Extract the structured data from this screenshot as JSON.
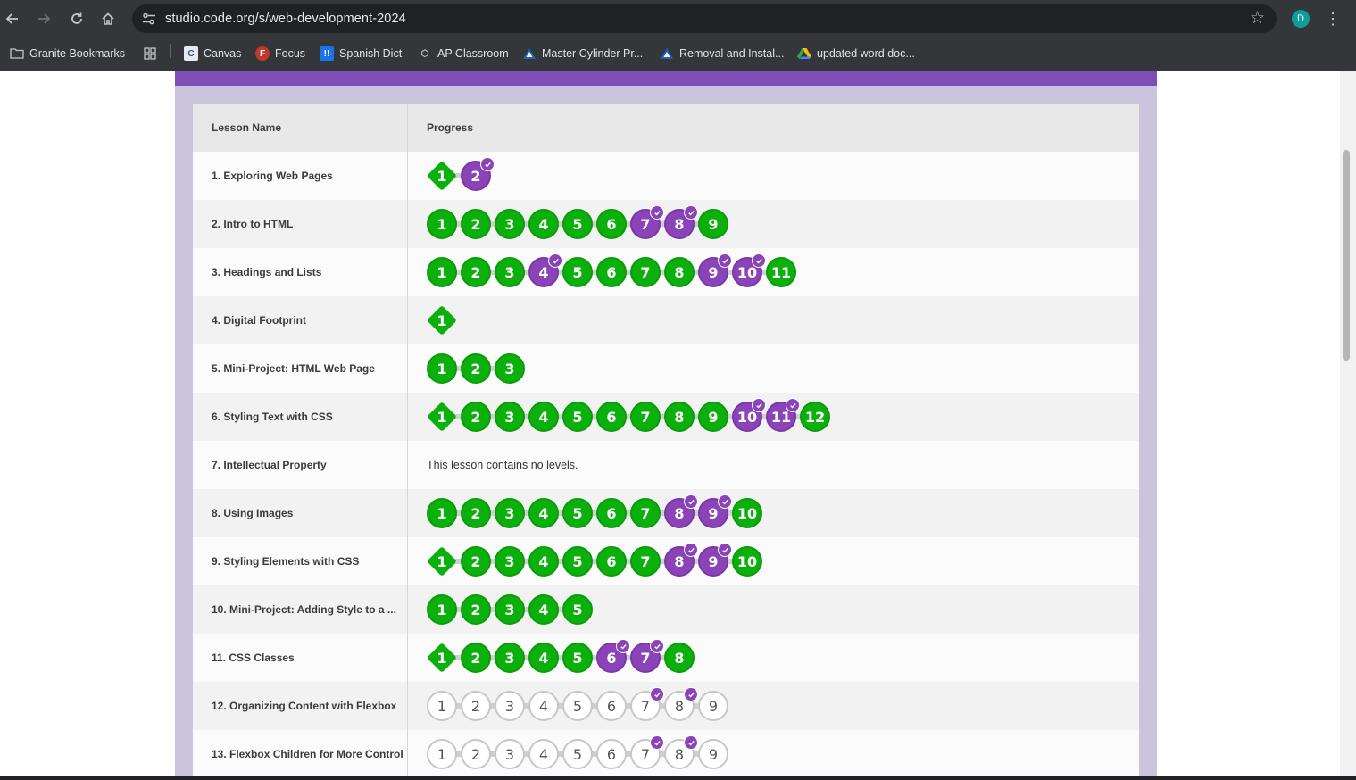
{
  "browser": {
    "url": "studio.code.org/s/web-development-2024",
    "profile_initial": "D",
    "bookmarks": [
      {
        "label": "Granite Bookmarks",
        "icon": "folder-icon"
      },
      {
        "label": "",
        "icon": "apps-grid-icon"
      },
      {
        "label": "Canvas",
        "icon": "canvas-icon"
      },
      {
        "label": "Focus",
        "icon": "focus-icon"
      },
      {
        "label": "Spanish Dict",
        "icon": "spanishdict-icon"
      },
      {
        "label": "AP Classroom",
        "icon": "apclassroom-icon"
      },
      {
        "label": "Master Cylinder Pr...",
        "icon": "alldata-icon"
      },
      {
        "label": "Removal and Instal...",
        "icon": "alldata-icon"
      },
      {
        "label": "updated word doc...",
        "icon": "drive-icon"
      }
    ]
  },
  "table": {
    "headers": {
      "lesson": "Lesson Name",
      "progress": "Progress"
    },
    "no_levels_text": "This lesson contains no levels.",
    "rows": [
      {
        "name": "1. Exploring Web Pages",
        "levels": [
          {
            "n": "1",
            "s": "diamond"
          },
          {
            "n": "2",
            "s": "purple",
            "c": true
          }
        ]
      },
      {
        "name": "2. Intro to HTML",
        "levels": [
          {
            "n": "1",
            "s": "green"
          },
          {
            "n": "2",
            "s": "green"
          },
          {
            "n": "3",
            "s": "green"
          },
          {
            "n": "4",
            "s": "green"
          },
          {
            "n": "5",
            "s": "green"
          },
          {
            "n": "6",
            "s": "green"
          },
          {
            "n": "7",
            "s": "purple",
            "c": true
          },
          {
            "n": "8",
            "s": "purple",
            "c": true
          },
          {
            "n": "9",
            "s": "green"
          }
        ]
      },
      {
        "name": "3. Headings and Lists",
        "levels": [
          {
            "n": "1",
            "s": "green"
          },
          {
            "n": "2",
            "s": "green"
          },
          {
            "n": "3",
            "s": "green"
          },
          {
            "n": "4",
            "s": "purple",
            "c": true
          },
          {
            "n": "5",
            "s": "green"
          },
          {
            "n": "6",
            "s": "green"
          },
          {
            "n": "7",
            "s": "green"
          },
          {
            "n": "8",
            "s": "green"
          },
          {
            "n": "9",
            "s": "purple",
            "c": true
          },
          {
            "n": "10",
            "s": "purple",
            "c": true
          },
          {
            "n": "11",
            "s": "green"
          }
        ]
      },
      {
        "name": "4. Digital Footprint",
        "levels": [
          {
            "n": "1",
            "s": "diamond"
          }
        ]
      },
      {
        "name": "5. Mini-Project: HTML Web Page",
        "levels": [
          {
            "n": "1",
            "s": "green"
          },
          {
            "n": "2",
            "s": "green"
          },
          {
            "n": "3",
            "s": "green"
          }
        ]
      },
      {
        "name": "6. Styling Text with CSS",
        "levels": [
          {
            "n": "1",
            "s": "diamond"
          },
          {
            "n": "2",
            "s": "green"
          },
          {
            "n": "3",
            "s": "green"
          },
          {
            "n": "4",
            "s": "green"
          },
          {
            "n": "5",
            "s": "green"
          },
          {
            "n": "6",
            "s": "green"
          },
          {
            "n": "7",
            "s": "green"
          },
          {
            "n": "8",
            "s": "green"
          },
          {
            "n": "9",
            "s": "green"
          },
          {
            "n": "10",
            "s": "purple",
            "c": true
          },
          {
            "n": "11",
            "s": "purple",
            "c": true
          },
          {
            "n": "12",
            "s": "green"
          }
        ]
      },
      {
        "name": "7. Intellectual Property",
        "levels": []
      },
      {
        "name": "8. Using Images",
        "levels": [
          {
            "n": "1",
            "s": "green"
          },
          {
            "n": "2",
            "s": "green"
          },
          {
            "n": "3",
            "s": "green"
          },
          {
            "n": "4",
            "s": "green"
          },
          {
            "n": "5",
            "s": "green"
          },
          {
            "n": "6",
            "s": "green"
          },
          {
            "n": "7",
            "s": "green"
          },
          {
            "n": "8",
            "s": "purple",
            "c": true
          },
          {
            "n": "9",
            "s": "purple",
            "c": true
          },
          {
            "n": "10",
            "s": "green"
          }
        ]
      },
      {
        "name": "9. Styling Elements with CSS",
        "levels": [
          {
            "n": "1",
            "s": "diamond"
          },
          {
            "n": "2",
            "s": "green"
          },
          {
            "n": "3",
            "s": "green"
          },
          {
            "n": "4",
            "s": "green"
          },
          {
            "n": "5",
            "s": "green"
          },
          {
            "n": "6",
            "s": "green"
          },
          {
            "n": "7",
            "s": "green"
          },
          {
            "n": "8",
            "s": "purple",
            "c": true
          },
          {
            "n": "9",
            "s": "purple",
            "c": true
          },
          {
            "n": "10",
            "s": "green"
          }
        ]
      },
      {
        "name": "10. Mini-Project: Adding Style to a ...",
        "levels": [
          {
            "n": "1",
            "s": "green"
          },
          {
            "n": "2",
            "s": "green"
          },
          {
            "n": "3",
            "s": "green"
          },
          {
            "n": "4",
            "s": "green"
          },
          {
            "n": "5",
            "s": "green"
          }
        ]
      },
      {
        "name": "11. CSS Classes",
        "levels": [
          {
            "n": "1",
            "s": "diamond"
          },
          {
            "n": "2",
            "s": "green"
          },
          {
            "n": "3",
            "s": "green"
          },
          {
            "n": "4",
            "s": "green"
          },
          {
            "n": "5",
            "s": "green"
          },
          {
            "n": "6",
            "s": "purple",
            "c": true
          },
          {
            "n": "7",
            "s": "purple",
            "c": true
          },
          {
            "n": "8",
            "s": "green"
          }
        ]
      },
      {
        "name": "12. Organizing Content with Flexbox",
        "levels": [
          {
            "n": "1",
            "s": "empty"
          },
          {
            "n": "2",
            "s": "empty"
          },
          {
            "n": "3",
            "s": "empty"
          },
          {
            "n": "4",
            "s": "empty"
          },
          {
            "n": "5",
            "s": "empty"
          },
          {
            "n": "6",
            "s": "empty"
          },
          {
            "n": "7",
            "s": "empty",
            "c": true
          },
          {
            "n": "8",
            "s": "empty",
            "c": true
          },
          {
            "n": "9",
            "s": "empty"
          }
        ]
      },
      {
        "name": "13. Flexbox Children for More Control",
        "levels": [
          {
            "n": "1",
            "s": "empty"
          },
          {
            "n": "2",
            "s": "empty"
          },
          {
            "n": "3",
            "s": "empty"
          },
          {
            "n": "4",
            "s": "empty"
          },
          {
            "n": "5",
            "s": "empty"
          },
          {
            "n": "6",
            "s": "empty"
          },
          {
            "n": "7",
            "s": "empty",
            "c": true
          },
          {
            "n": "8",
            "s": "empty",
            "c": true
          },
          {
            "n": "9",
            "s": "empty"
          }
        ]
      }
    ]
  },
  "colors": {
    "completed": "#0cb00c",
    "assessment": "#8b44b8",
    "not_started": "#ffffff",
    "panel": "#cbc4dd",
    "panel_top": "#7e4fb7"
  }
}
